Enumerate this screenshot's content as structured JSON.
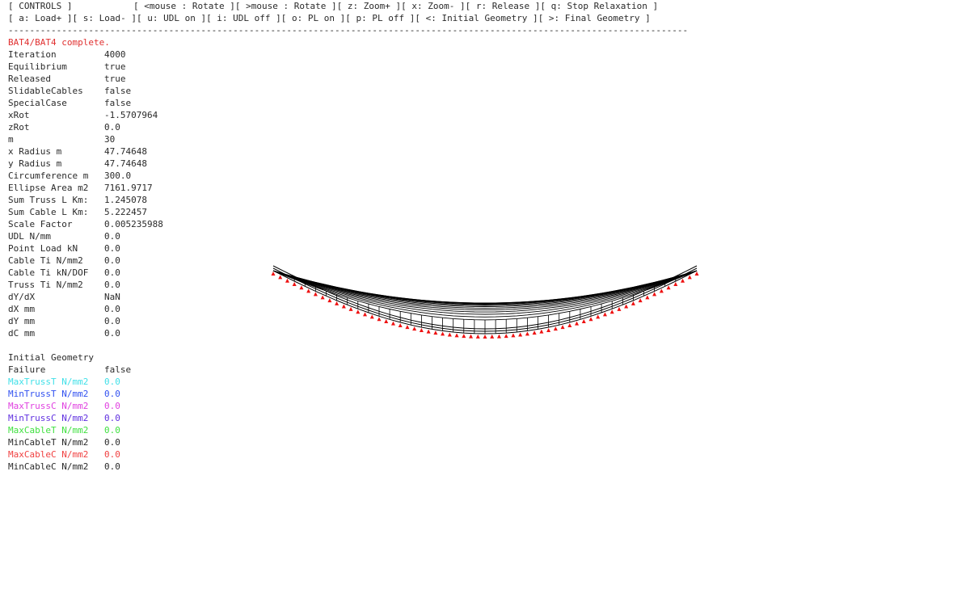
{
  "controls": {
    "title": "[ CONTROLS ]",
    "row1": [
      "[ <mouse : Rotate ]",
      "[ >mouse : Rotate ]",
      "[ z: Zoom+ ]",
      "[ x: Zoom- ]",
      "[ r: Release ]",
      "[ q: Stop Relaxation ]"
    ],
    "row2": [
      "[ a: Load+ ]",
      "[ s: Load- ]",
      "[ u: UDL on ]",
      "[ i: UDL off ]",
      "[ o: PL on ]",
      "[ p: PL off ]",
      "[ <: Initial Geometry ]",
      "[ >: Final Geometry ]"
    ]
  },
  "separator": "-------------------------------------------------------------------------------------------------------------------------------",
  "status": {
    "text": "BAT4/BAT4 complete.",
    "color": "#e03030"
  },
  "params": [
    {
      "label": "Iteration",
      "value": "4000"
    },
    {
      "label": "Equilibrium",
      "value": "true"
    },
    {
      "label": "Released",
      "value": "true"
    },
    {
      "label": "SlidableCables",
      "value": "false"
    },
    {
      "label": "SpecialCase",
      "value": "false"
    },
    {
      "label": "xRot",
      "value": "-1.5707964"
    },
    {
      "label": "zRot",
      "value": "0.0"
    },
    {
      "label": "m",
      "value": "30"
    },
    {
      "label": "x Radius m",
      "value": "47.74648"
    },
    {
      "label": "y Radius m",
      "value": "47.74648"
    },
    {
      "label": "Circumference m",
      "value": "300.0"
    },
    {
      "label": "Ellipse Area m2",
      "value": "7161.9717"
    },
    {
      "label": "Sum Truss L Km:",
      "value": "1.245078"
    },
    {
      "label": "Sum Cable L Km:",
      "value": "5.222457"
    },
    {
      "label": "Scale Factor",
      "value": "0.005235988"
    },
    {
      "label": "UDL N/mm",
      "value": "0.0"
    },
    {
      "label": "Point Load kN",
      "value": "0.0"
    },
    {
      "label": "Cable Ti N/mm2",
      "value": "0.0"
    },
    {
      "label": "Cable Ti kN/DOF",
      "value": "0.0"
    },
    {
      "label": "Truss Ti N/mm2",
      "value": "0.0"
    },
    {
      "label": "dY/dX",
      "value": "NaN"
    },
    {
      "label": "dX mm",
      "value": "0.0"
    },
    {
      "label": "dY mm",
      "value": "0.0"
    },
    {
      "label": "dC mm",
      "value": "0.0"
    }
  ],
  "geometry_section": {
    "title": "Initial Geometry",
    "failure_label": "Failure",
    "failure_value": "false"
  },
  "stress": [
    {
      "label": "MaxTrussT N/mm2",
      "value": "0.0",
      "color": "#40e0e8"
    },
    {
      "label": "MinTrussT N/mm2",
      "value": "0.0",
      "color": "#3050f0"
    },
    {
      "label": "MaxTrussC N/mm2",
      "value": "0.0",
      "color": "#e040e0"
    },
    {
      "label": "MinTrussC N/mm2",
      "value": "0.0",
      "color": "#6030e0"
    },
    {
      "label": "MaxCableT N/mm2",
      "value": "0.0",
      "color": "#40e040"
    },
    {
      "label": "MinCableT N/mm2",
      "value": "0.0",
      "color": "#2a2a2a"
    },
    {
      "label": "MaxCableC N/mm2",
      "value": "0.0",
      "color": "#f04040"
    },
    {
      "label": "MinCableC N/mm2",
      "value": "0.0",
      "color": "#2a2a2a"
    }
  ],
  "model": {
    "m": 30,
    "support_color": "#ee1111",
    "line_color": "#000000"
  }
}
